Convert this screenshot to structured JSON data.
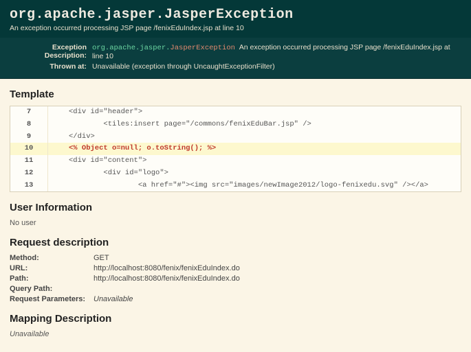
{
  "header": {
    "title_pkg": "org.apache.jasper.",
    "title_cls": "JasperException",
    "subtitle": "An exception occurred processing JSP page /fenixEduIndex.jsp at line 10"
  },
  "meta": {
    "desc_label": "Exception Description:",
    "desc_pkg": "org.apache.jasper.",
    "desc_cls": "JasperException",
    "desc_msg": "An exception occurred processing JSP page /fenixEduIndex.jsp at line 10",
    "thrown_label": "Thrown at:",
    "thrown_val": "Unavailable (exception through UncaughtExceptionFilter)"
  },
  "sections": {
    "template": "Template",
    "user_info": "User Information",
    "request_desc": "Request description",
    "mapping_desc": "Mapping Description"
  },
  "template_lines": [
    {
      "n": "7",
      "code": "<div id=\"header\">",
      "hl": false
    },
    {
      "n": "8",
      "code": "        <tiles:insert page=\"/commons/fenixEduBar.jsp\" />",
      "hl": false
    },
    {
      "n": "9",
      "code": "</div>",
      "hl": false
    },
    {
      "n": "10",
      "code": "<% Object o=null; o.toString(); %>",
      "hl": true
    },
    {
      "n": "11",
      "code": "<div id=\"content\">",
      "hl": false
    },
    {
      "n": "12",
      "code": "        <div id=\"logo\">",
      "hl": false
    },
    {
      "n": "13",
      "code": "                <a href=\"#\"><img src=\"images/newImage2012/logo-fenixedu.svg\" /></a>",
      "hl": false
    }
  ],
  "user_info_text": "No user",
  "request": {
    "method_k": "Method:",
    "method_v": "GET",
    "url_k": "URL:",
    "url_v": "http://localhost:8080/fenix/fenixEduIndex.do",
    "path_k": "Path:",
    "path_v": "http://localhost:8080/fenix/fenixEduIndex.do",
    "query_k": "Query Path:",
    "query_v": "",
    "params_k": "Request Parameters:",
    "params_v": "Unavailable"
  },
  "mapping_text": "Unavailable"
}
